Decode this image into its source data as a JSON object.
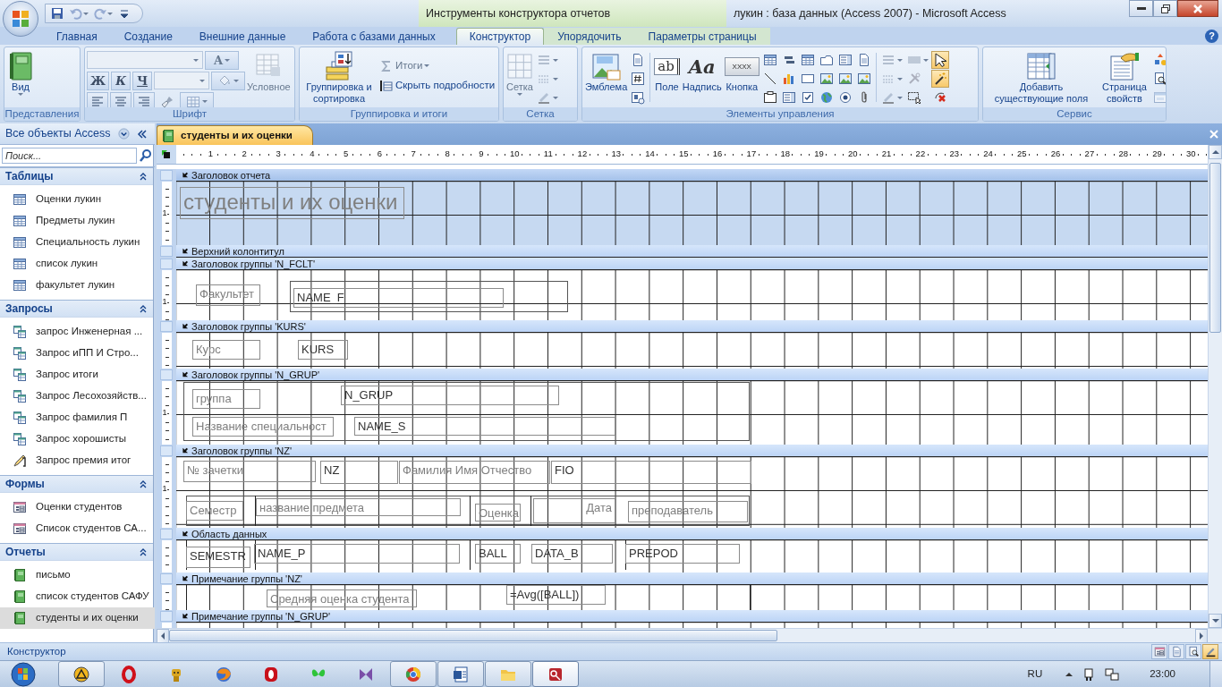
{
  "title_bar": {
    "contextual_tab": "Инструменты конструктора отчетов",
    "title": "лукин : база данных (Access 2007)  -  Microsoft Access"
  },
  "quick_access": [
    {
      "kind": "save",
      "disabled": false
    },
    {
      "kind": "undo",
      "disabled": true
    },
    {
      "kind": "redo",
      "disabled": true
    },
    {
      "kind": "customize",
      "disabled": false
    }
  ],
  "ribbon_tabs": [
    {
      "label": "Главная",
      "selected": false,
      "contextual": false
    },
    {
      "label": "Создание",
      "selected": false,
      "contextual": false
    },
    {
      "label": "Внешние данные",
      "selected": false,
      "contextual": false
    },
    {
      "label": "Работа с базами данных",
      "selected": false,
      "contextual": false
    },
    {
      "label": "Конструктор",
      "selected": true,
      "contextual": true
    },
    {
      "label": "Упорядочить",
      "selected": false,
      "contextual": true
    },
    {
      "label": "Параметры страницы",
      "selected": false,
      "contextual": true
    }
  ],
  "help": "?",
  "ribbon_groups": [
    {
      "label": "Представления",
      "items": [
        {
          "kind": "large",
          "label": "Вид",
          "disabled": false,
          "dropdown": true
        }
      ]
    },
    {
      "label": "Шрифт",
      "rows": [
        [
          {
            "kind": "combo",
            "disabled": true
          },
          {
            "kind": "glyph",
            "glyph": "A",
            "disabled": true,
            "dropdown": true
          }
        ],
        [
          {
            "kind": "glyph",
            "glyph": "Ж",
            "disabled": false
          },
          {
            "kind": "glyph",
            "glyph": "К",
            "disabled": false
          },
          {
            "kind": "glyph",
            "glyph": "Ч",
            "disabled": false
          },
          {
            "kind": "combo",
            "disabled": true
          },
          {
            "kind": "tool",
            "disabled": true,
            "dropdown": true
          }
        ],
        [
          {
            "kind": "tool",
            "disabled": false
          },
          {
            "kind": "tool",
            "disabled": false
          },
          {
            "kind": "tool",
            "disabled": false
          },
          {
            "kind": "tool",
            "disabled": false
          },
          {
            "kind": "tool",
            "disabled": true,
            "dropdown": true
          }
        ]
      ],
      "items": [
        {
          "kind": "large",
          "label": "Условное",
          "disabled": true
        }
      ]
    },
    {
      "label": "Группировка и итоги",
      "items": [
        {
          "kind": "large",
          "label": "Группировка и сортировка",
          "disabled": false
        },
        {
          "kind": "small",
          "label": "Итоги",
          "disabled": true,
          "dropdown": true
        },
        {
          "kind": "small",
          "label": "Скрыть подробности",
          "disabled": false
        }
      ]
    },
    {
      "label": "Сетка",
      "items": [
        {
          "kind": "large",
          "label": "Сетка",
          "disabled": true,
          "dropdown": true
        },
        {
          "kind": "tool",
          "disabled": true,
          "dropdown": true
        },
        {
          "kind": "tool",
          "disabled": true,
          "dropdown": true
        },
        {
          "kind": "tool",
          "disabled": true,
          "dropdown": true
        }
      ]
    },
    {
      "label": "Элементы управления",
      "items": [
        {
          "kind": "large",
          "label": "Эмблема",
          "disabled": false
        },
        {
          "kind": "tool",
          "disabled": false
        },
        {
          "kind": "tool",
          "disabled": false
        },
        {
          "kind": "tool",
          "disabled": false
        },
        {
          "kind": "separator"
        },
        {
          "kind": "large",
          "label": "Поле",
          "glyph": "ab",
          "disabled": false
        },
        {
          "kind": "large",
          "label": "Надпись",
          "glyph": "Aa",
          "disabled": false
        },
        {
          "kind": "large",
          "label": "Кнопка",
          "glyph": "XXXX",
          "disabled": false
        },
        {
          "kind": "tool",
          "disabled": false
        },
        {
          "kind": "tool",
          "disabled": false
        },
        {
          "kind": "tool",
          "disabled": false
        },
        {
          "kind": "tool",
          "disabled": false
        },
        {
          "kind": "tool",
          "disabled": false
        },
        {
          "kind": "tool",
          "disabled": false
        },
        {
          "kind": "tool",
          "disabled": false
        },
        {
          "kind": "tool",
          "disabled": false
        },
        {
          "kind": "tool",
          "disabled": false
        },
        {
          "kind": "tool",
          "disabled": false
        },
        {
          "kind": "tool",
          "disabled": false
        },
        {
          "kind": "tool",
          "disabled": false
        },
        {
          "kind": "tool",
          "disabled": false
        },
        {
          "kind": "tool",
          "disabled": false
        },
        {
          "kind": "tool",
          "disabled": false
        },
        {
          "kind": "tool",
          "disabled": false
        },
        {
          "kind": "tool",
          "disabled": false
        },
        {
          "kind": "tool",
          "disabled": false
        },
        {
          "kind": "separator"
        },
        {
          "kind": "tool",
          "disabled": true,
          "dropdown": true
        },
        {
          "kind": "tool",
          "disabled": true,
          "dropdown": true
        },
        {
          "kind": "tool",
          "disabled": true,
          "dropdown": true
        },
        {
          "kind": "tool",
          "disabled": true,
          "dropdown": true
        },
        {
          "kind": "tool",
          "disabled": true
        },
        {
          "kind": "tool",
          "disabled": false
        },
        {
          "kind": "tool",
          "disabled": false,
          "selected": true
        },
        {
          "kind": "tool",
          "disabled": false,
          "selected": true
        },
        {
          "kind": "tool",
          "disabled": false,
          "selected": false
        }
      ]
    },
    {
      "label": "Сервис",
      "items": [
        {
          "kind": "large",
          "label": "Добавить существующие поля",
          "disabled": false
        },
        {
          "kind": "large",
          "label": "Страница свойств",
          "disabled": false
        },
        {
          "kind": "tool",
          "disabled": false
        },
        {
          "kind": "tool",
          "disabled": false
        },
        {
          "kind": "tool",
          "disabled": true
        }
      ]
    }
  ],
  "navigation": {
    "title": "Все объекты Access",
    "search_placeholder": "Поиск...",
    "groups": [
      {
        "label": "Таблицы",
        "expanded": true,
        "items": [
          {
            "label": "Оценки лукин",
            "kind": "table",
            "selected": false
          },
          {
            "label": "Предметы лукин",
            "kind": "table",
            "selected": false
          },
          {
            "label": "Специальность лукин",
            "kind": "table",
            "selected": false
          },
          {
            "label": "список лукин",
            "kind": "table",
            "selected": false
          },
          {
            "label": "факультет лукин",
            "kind": "table",
            "selected": false
          }
        ]
      },
      {
        "label": "Запросы",
        "expanded": true,
        "items": [
          {
            "label": "запрос Инженерная ...",
            "kind": "query",
            "selected": false
          },
          {
            "label": "Запрос иПП  И Стро...",
            "kind": "query",
            "selected": false
          },
          {
            "label": "Запрос итоги",
            "kind": "query",
            "selected": false
          },
          {
            "label": "Запрос Лесохозяйств...",
            "kind": "query",
            "selected": false
          },
          {
            "label": "Запрос фамилия П",
            "kind": "query",
            "selected": false
          },
          {
            "label": "Запрос хорошисты",
            "kind": "query",
            "selected": false
          },
          {
            "label": "Запрос премия итог",
            "kind": "action_query",
            "selected": false
          }
        ]
      },
      {
        "label": "Формы",
        "expanded": true,
        "items": [
          {
            "label": "Оценки студентов",
            "kind": "form",
            "selected": false
          },
          {
            "label": "Список студентов СА...",
            "kind": "form",
            "selected": false
          }
        ]
      },
      {
        "label": "Отчеты",
        "expanded": true,
        "items": [
          {
            "label": "письмо",
            "kind": "report",
            "selected": false
          },
          {
            "label": "список студентов САФУ",
            "kind": "report",
            "selected": false
          },
          {
            "label": "студенты и их оценки",
            "kind": "report",
            "selected": true
          }
        ]
      }
    ]
  },
  "document_tab": {
    "label": "студенты и их оценки",
    "selected": true
  },
  "ruler": [
    "1",
    "2",
    "3",
    "4",
    "5",
    "6",
    "7",
    "8",
    "9",
    "10",
    "11",
    "12",
    "13",
    "14",
    "15",
    "16",
    "17",
    "18",
    "19",
    "20",
    "21",
    "22",
    "23",
    "24",
    "25",
    "26",
    "27",
    "28",
    "29",
    "30"
  ],
  "sections": [
    {
      "title": "Заголовок отчета",
      "selected": true,
      "ruler_label": "1",
      "controls": [
        {
          "kind": "title",
          "text": "студенты и их оценки"
        }
      ]
    },
    {
      "title": "Верхний колонтитул",
      "selected": false
    },
    {
      "title": "Заголовок группы 'N_FCLT'",
      "selected": false,
      "ruler_label": "1",
      "controls": [
        {
          "kind": "label",
          "text": "Факультет"
        },
        {
          "kind": "rectangle"
        },
        {
          "kind": "textbox",
          "text": "NAME_F"
        }
      ]
    },
    {
      "title": "Заголовок группы 'KURS'",
      "selected": false,
      "controls": [
        {
          "kind": "label",
          "text": "Курс"
        },
        {
          "kind": "textbox",
          "text": "KURS"
        }
      ]
    },
    {
      "title": "Заголовок группы 'N_GRUP'",
      "selected": false,
      "ruler_label": "1",
      "controls": [
        {
          "kind": "rectangle"
        },
        {
          "kind": "label",
          "text": "группа"
        },
        {
          "kind": "textbox",
          "text": "N_GRUP"
        },
        {
          "kind": "label",
          "text": "Название специальност"
        },
        {
          "kind": "textbox",
          "text": "NAME_S"
        }
      ]
    },
    {
      "title": "Заголовок группы 'NZ'",
      "selected": false,
      "ruler_label": "1",
      "controls": [
        {
          "kind": "label",
          "text": "№ зачетки"
        },
        {
          "kind": "textbox",
          "text": "NZ"
        },
        {
          "kind": "label",
          "text": "Фамилия Имя Отчество"
        },
        {
          "kind": "textbox",
          "text": "FIO"
        },
        {
          "kind": "rectangle"
        },
        {
          "kind": "line"
        },
        {
          "kind": "line"
        },
        {
          "kind": "line"
        },
        {
          "kind": "label",
          "text": "Семестр"
        },
        {
          "kind": "label",
          "text": "название предмета"
        },
        {
          "kind": "label",
          "text": "Оценка"
        },
        {
          "kind": "label",
          "text": "Дата"
        },
        {
          "kind": "label",
          "text": "преподаватель"
        }
      ]
    },
    {
      "title": "Область данных",
      "selected": false,
      "controls": [
        {
          "kind": "line"
        },
        {
          "kind": "line"
        },
        {
          "kind": "line"
        },
        {
          "kind": "line"
        },
        {
          "kind": "textbox",
          "text": "SEMESTR"
        },
        {
          "kind": "textbox",
          "text": "NAME_P"
        },
        {
          "kind": "textbox",
          "text": "BALL"
        },
        {
          "kind": "textbox",
          "text": "DATA_B"
        },
        {
          "kind": "textbox",
          "text": "PREPOD"
        }
      ]
    },
    {
      "title": "Примечание группы 'NZ'",
      "selected": false,
      "controls": [
        {
          "kind": "line"
        },
        {
          "kind": "line"
        },
        {
          "kind": "label",
          "text": "Средняя оценка студента"
        },
        {
          "kind": "textbox",
          "text": "=Avg([BALL])"
        }
      ]
    },
    {
      "title": "Примечание группы 'N_GRUP'",
      "selected": false
    }
  ],
  "status_bar": {
    "text": "Конструктор",
    "view_buttons": [
      {
        "selected": false
      },
      {
        "selected": false
      },
      {
        "selected": false
      },
      {
        "selected": true
      }
    ]
  },
  "taskbar": {
    "apps": [
      {
        "running": true,
        "active": false
      },
      {
        "running": false,
        "active": false
      },
      {
        "running": false,
        "active": false
      },
      {
        "running": false,
        "active": false
      },
      {
        "running": false,
        "active": false
      },
      {
        "running": false,
        "active": false
      },
      {
        "running": false,
        "active": false
      },
      {
        "running": true,
        "active": false
      },
      {
        "running": true,
        "active": false
      },
      {
        "running": true,
        "active": false
      },
      {
        "running": true,
        "active": true
      }
    ],
    "language": "RU",
    "clock": "23:00"
  }
}
